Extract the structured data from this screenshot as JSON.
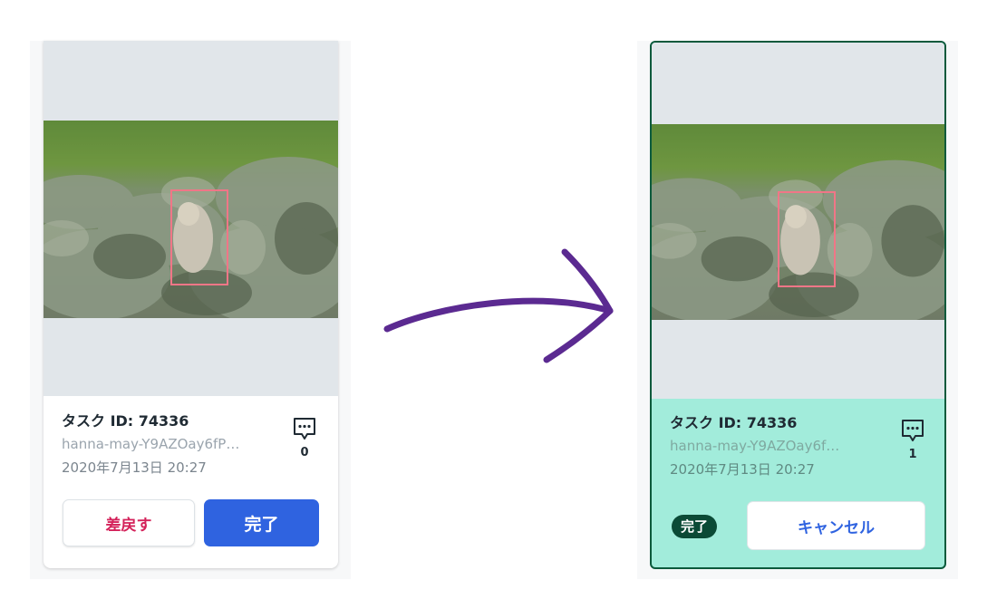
{
  "before_card": {
    "task_id": "タスク ID: 74336",
    "file_name": "hanna-may-Y9AZOay6fP…",
    "date": "2020年7月13日 20:27",
    "comment_count": "0",
    "return_button": "差戻す",
    "complete_button": "完了"
  },
  "after_card": {
    "task_id": "タスク ID: 74336",
    "file_name": "hanna-may-Y9AZOay6f…",
    "date": "2020年7月13日 20:27",
    "comment_count": "1",
    "status_badge": "完了",
    "cancel_button": "キャンセル"
  },
  "colors": {
    "accent_blue": "#2f63e0",
    "return_red": "#d4225a",
    "complete_bg": "#a2ecdb",
    "complete_border": "#0b5a3c",
    "arrow_purple": "#5b2a91",
    "bbox_pink": "#f07687"
  },
  "icons": [
    "comment-icon",
    "arrow-icon"
  ]
}
